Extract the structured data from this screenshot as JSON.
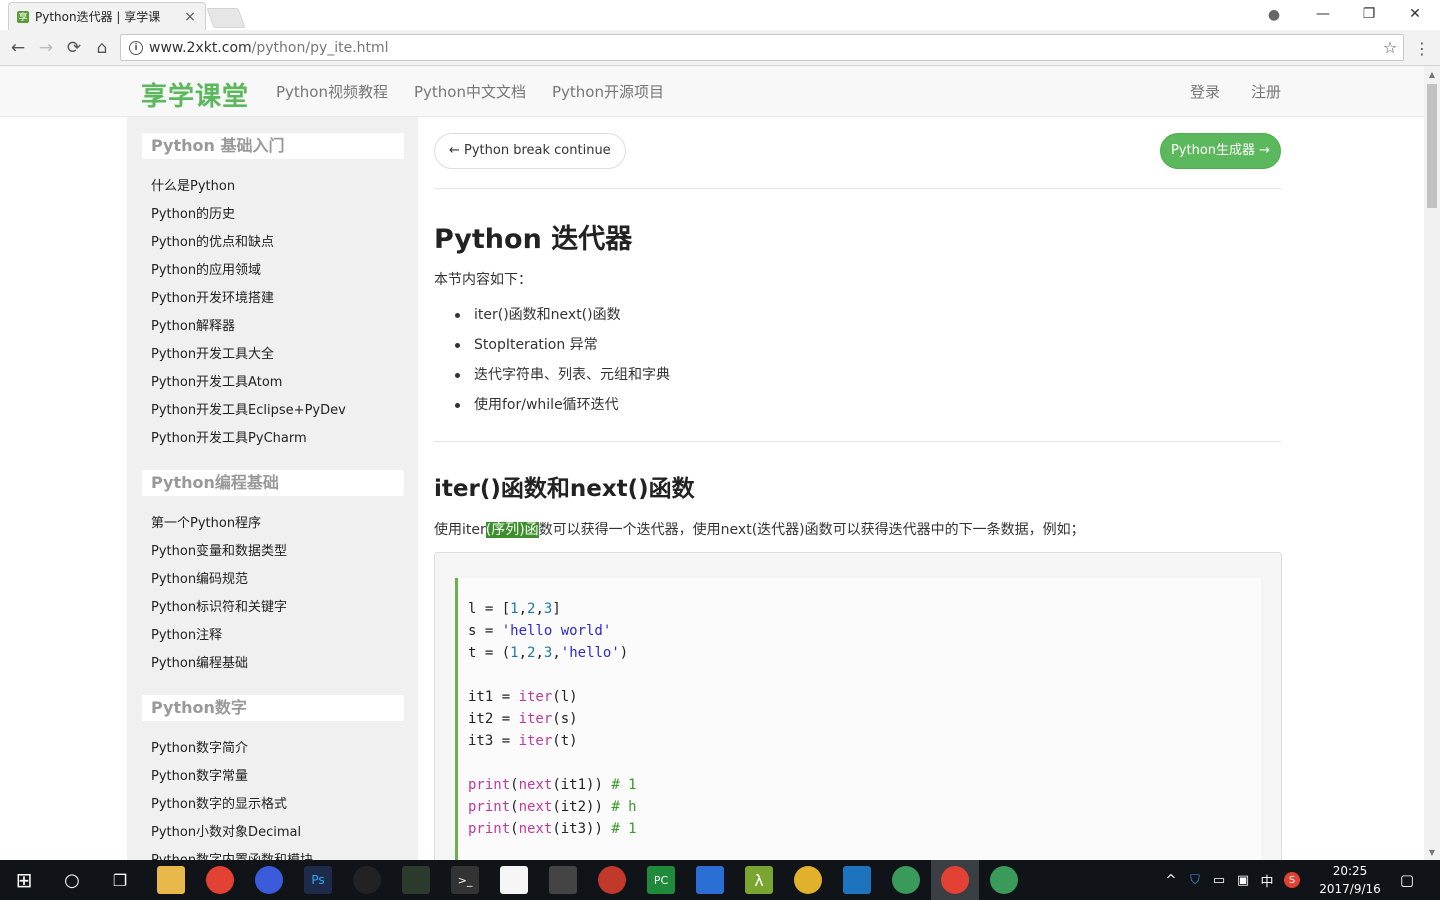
{
  "browser": {
    "tab_title": "Python迭代器 | 享学课",
    "tab_favicon": "享",
    "url_host": "www.2xkt.com",
    "url_path": "/python/py_ite.html",
    "back_icon": "←",
    "forward_icon": "→",
    "reload_icon": "⟳",
    "home_icon": "⌂",
    "star_icon": "☆",
    "menu_icon": "⋮",
    "close_tab_icon": "×",
    "minimize_icon": "—",
    "restore_icon": "❐",
    "close_icon": "✕",
    "profile_icon": "●"
  },
  "header": {
    "logo": "享学课堂",
    "nav": [
      "Python视频教程",
      "Python中文文档",
      "Python开源项目"
    ],
    "login": "登录",
    "register": "注册"
  },
  "sidebar": {
    "sections": [
      {
        "title": "Python 基础入门",
        "items": [
          "什么是Python",
          "Python的历史",
          "Python的优点和缺点",
          "Python的应用领域",
          "Python开发环境搭建",
          "Python解释器",
          "Python开发工具大全",
          "Python开发工具Atom",
          "Python开发工具Eclipse+PyDev",
          "Python开发工具PyCharm"
        ]
      },
      {
        "title": "Python编程基础",
        "items": [
          "第一个Python程序",
          "Python变量和数据类型",
          "Python编码规范",
          "Python标识符和关键字",
          "Python注释",
          "Python编程基础"
        ]
      },
      {
        "title": "Python数字",
        "items": [
          "Python数字简介",
          "Python数字常量",
          "Python数字的显示格式",
          "Python小数对象Decimal",
          "Python数字内置函数和模块"
        ]
      }
    ]
  },
  "main": {
    "prev_button": "← Python break continue",
    "next_button": "Python生成器 →",
    "title": "Python 迭代器",
    "intro": "本节内容如下：",
    "toc": [
      "iter()函数和next()函数",
      "StopIteration 异常",
      "迭代字符串、列表、元组和字典",
      "使用for/while循环迭代"
    ],
    "section_title": "iter()函数和next()函数",
    "para_before": "使用iter",
    "para_selected": "(序列)函",
    "para_after": "数可以获得一个迭代器，使用next(迭代器)函数可以获得迭代器中的下一条数据，例如；"
  },
  "code": {
    "l1_a": "l = [",
    "l1_n1": "1",
    "l1_c1": ",",
    "l1_n2": "2",
    "l1_c2": ",",
    "l1_n3": "3",
    "l1_b": "]",
    "l2_a": "s = ",
    "l2_s": "'hello world'",
    "l3_a": "t = (",
    "l3_n1": "1",
    "l3_c1": ",",
    "l3_n2": "2",
    "l3_c2": ",",
    "l3_n3": "3",
    "l3_c3": ",",
    "l3_s": "'hello'",
    "l3_b": ")",
    "l5_a": "it1 = ",
    "l5_k": "iter",
    "l5_b": "(l)",
    "l6_a": "it2 = ",
    "l6_k": "iter",
    "l6_b": "(s)",
    "l7_a": "it3 = ",
    "l7_k": "iter",
    "l7_b": "(t)",
    "l9_k1": "print",
    "l9_p1": "(",
    "l9_k2": "next",
    "l9_b": "(it1)) ",
    "l9_c": "# 1",
    "l10_k1": "print",
    "l10_p1": "(",
    "l10_k2": "next",
    "l10_b": "(it2)) ",
    "l10_c": "# h",
    "l11_k1": "print",
    "l11_p1": "(",
    "l11_k2": "next",
    "l11_b": "(it3)) ",
    "l11_c": "# 1"
  },
  "taskbar": {
    "start_icon": "⊞",
    "search_icon": "○",
    "taskview_icon": "❐",
    "clock_time": "20:25",
    "clock_date": "2017/9/16",
    "ime_label": "中",
    "tray_up_icon": "^"
  },
  "colors": {
    "brand_green": "#5cb85c",
    "selection_green": "#3c8f2c",
    "code_keyword": "#c0399d",
    "code_number": "#1d7a9e",
    "code_string": "#2a2ad0",
    "code_comment": "#3a9a2a"
  }
}
